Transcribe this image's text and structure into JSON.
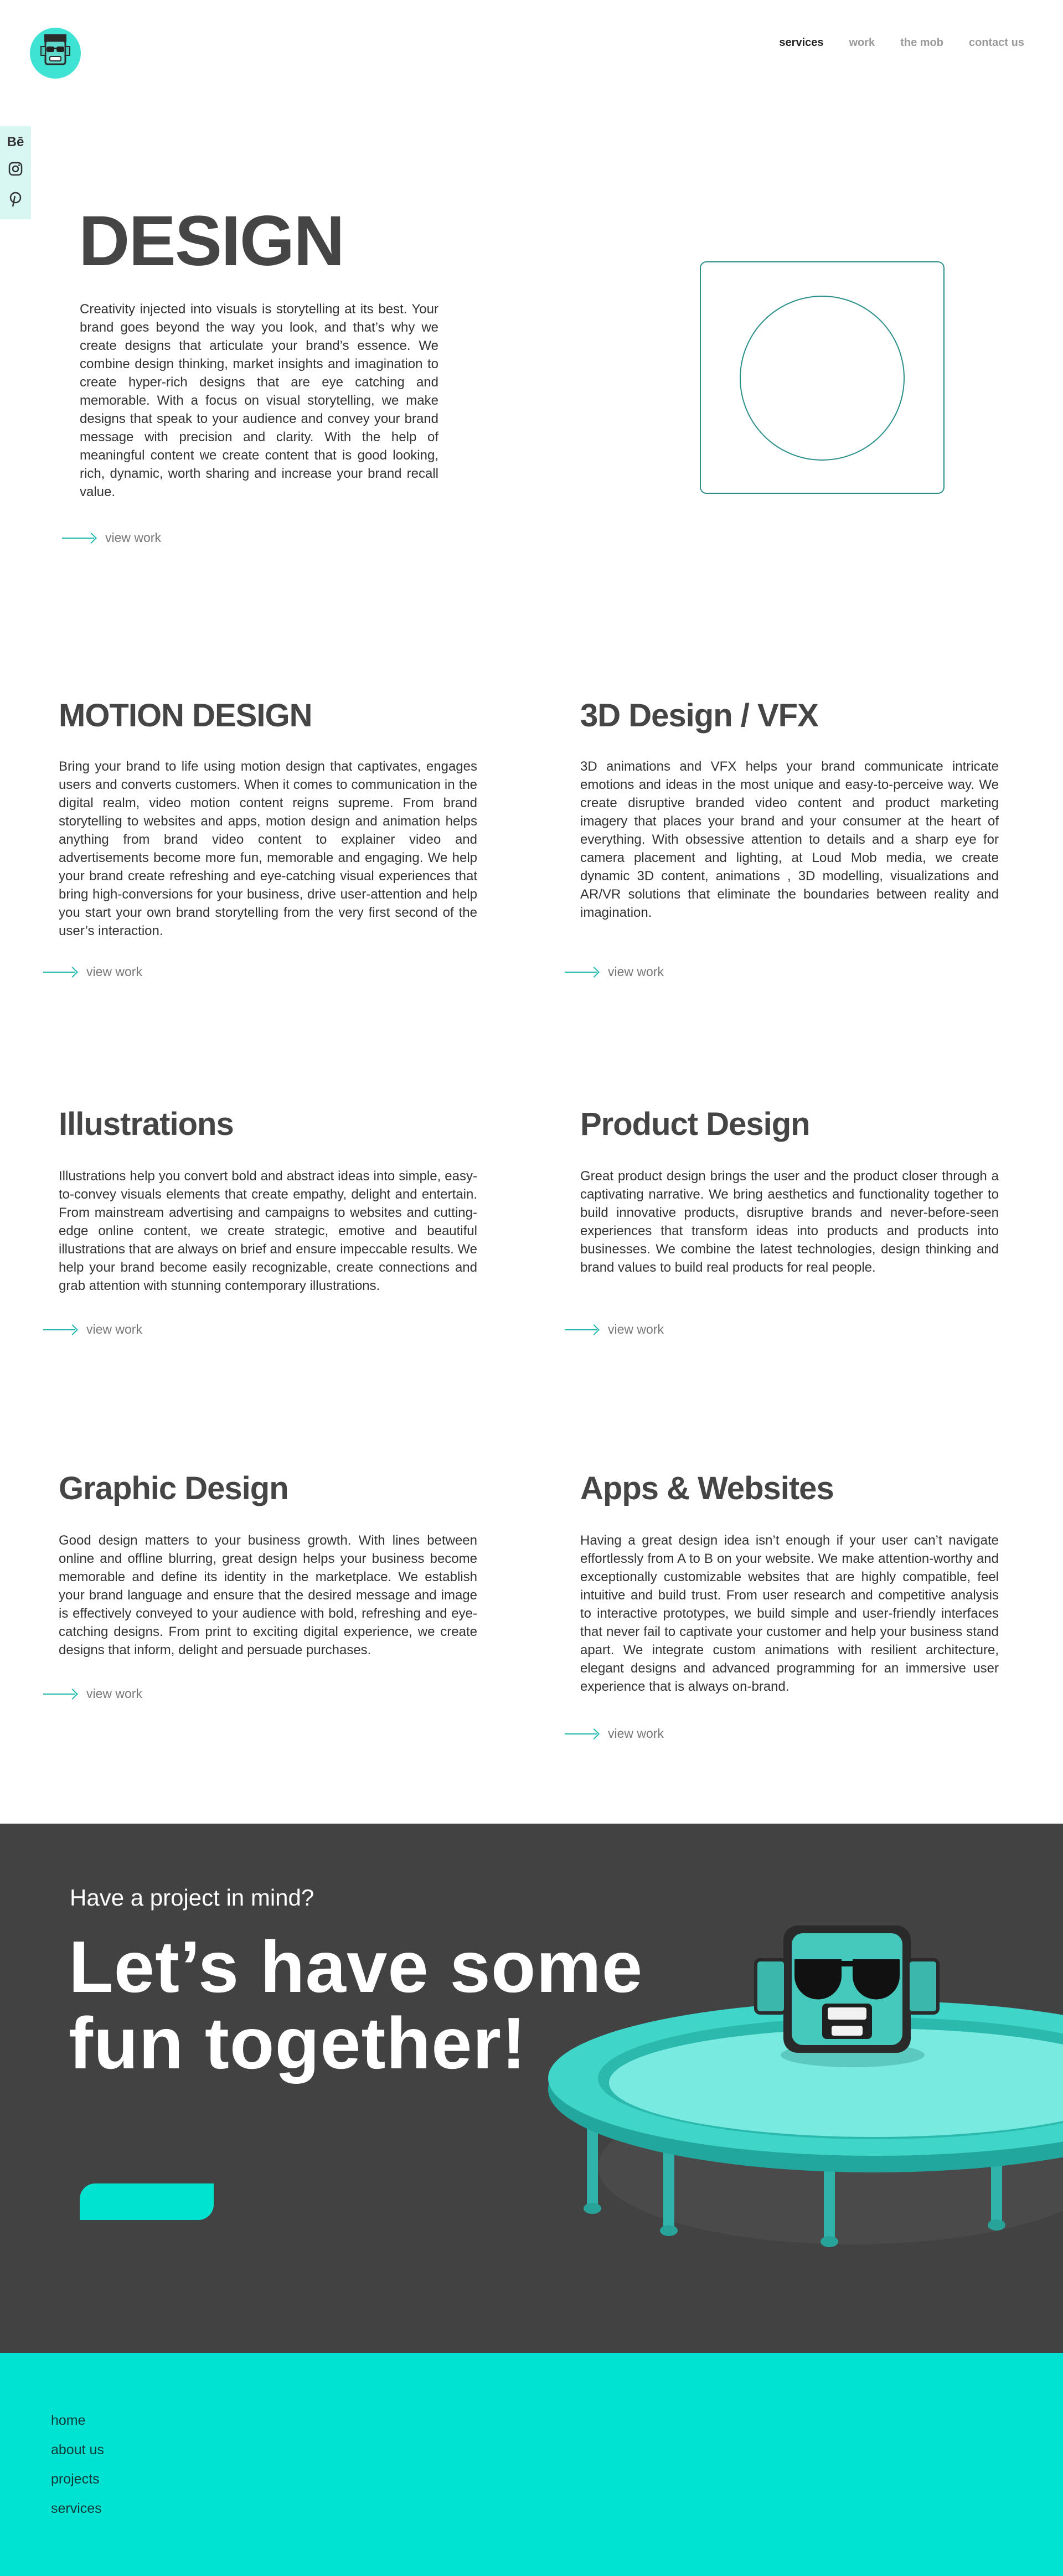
{
  "header": {
    "nav": [
      {
        "label": "services",
        "active": true
      },
      {
        "label": "work",
        "active": false
      },
      {
        "label": "the mob",
        "active": false
      },
      {
        "label": "contact us",
        "active": false
      }
    ]
  },
  "social": [
    {
      "icon": "behance-icon",
      "glyph": "Bē"
    },
    {
      "icon": "instagram-icon",
      "glyph": "◎"
    },
    {
      "icon": "pinterest-icon",
      "glyph": "𝒫"
    }
  ],
  "hero": {
    "title": "DESIGN",
    "text": "Creativity injected into visuals is storytelling at its best. Your brand goes beyond the way you look, and that’s why we create designs that articulate your brand’s essence. We combine design thinking, market insights and imagination to create hyper-rich designs that are eye catching and memorable. With a focus on visual storytelling, we make designs that speak to your audience and convey your brand message with precision and clarity. With the help of meaningful content we create content that is good looking, rich, dynamic, worth sharing and increase your brand recall value.",
    "link": "view work"
  },
  "services": [
    {
      "title": "MOTION DESIGN",
      "text": "Bring your brand to life using motion design that captivates, engages users and converts customers. When it comes to communication in the digital realm, video motion content reigns supreme. From brand storytelling to websites and apps, motion design and animation helps anything from brand video content to explainer video and advertisements become more fun, memorable and engaging. We help your brand create refreshing and eye-catching visual experiences that bring high-conversions for your business, drive user-attention and help you start your own brand storytelling from the very first second of the user’s interaction.",
      "link": "view work"
    },
    {
      "title": "3D Design / VFX",
      "text": "3D animations and VFX helps your brand communicate intricate emotions and ideas in the most unique and easy-to-perceive way. We create disruptive branded video content and product marketing imagery that places your brand and your consumer at the heart of everything. With obsessive attention to details and a sharp eye for camera placement and lighting, at Loud Mob media, we create dynamic 3D content, animations , 3D modelling, visualizations and AR/VR solutions that eliminate the boundaries between reality and imagination.",
      "link": "view work"
    },
    {
      "title": "Illustrations",
      "text": "Illustrations help you convert bold and abstract ideas into simple, easy-to-convey visuals elements that create empathy, delight and entertain. From mainstream advertising and campaigns to websites and cutting-edge online content, we create strategic, emotive and beautiful illustrations that are always on brief and ensure impeccable results. We help your brand become easily recognizable, create connections and grab attention with stunning contemporary illustrations.",
      "link": "view work"
    },
    {
      "title": "Product Design",
      "text": "Great product design brings the user and the product closer through a captivating narrative. We bring aesthetics and functionality together to build innovative products, disruptive brands and never-before-seen experiences that transform ideas into products and products into businesses. We combine the latest technologies, design thinking and brand values to build real products for real people.",
      "link": "view work"
    },
    {
      "title": "Graphic Design",
      "text": "Good design matters to your business growth. With lines between online and offline blurring, great design helps your business become memorable and define its identity in the marketplace. We establish your brand language and ensure that the desired message and image is effectively conveyed to your audience with bold, refreshing and eye-catching designs. From print to exciting digital experience, we create designs that inform, delight and persuade purchases.",
      "link": "view work"
    },
    {
      "title": "Apps & Websites",
      "text": "Having a great design idea isn’t enough if your user can’t navigate effortlessly from A to B on your website. We make attention-worthy and exceptionally customizable websites that are highly compatible, feel intuitive and build trust. From user research and competitive analysis to interactive prototypes, we build simple and user-friendly interfaces that never fail to captivate your customer and help your business stand apart. We integrate custom animations with resilient architecture, elegant designs and advanced programming for an immersive user experience that is always on-brand.",
      "link": "view work"
    }
  ],
  "cta": {
    "kicker": "Have a project in mind?",
    "headline_1": "Let’s have some",
    "headline_2": "fun together!"
  },
  "footer": {
    "links": [
      "home",
      "about us",
      "projects",
      "services"
    ]
  },
  "colors": {
    "accent": "#00e3d3",
    "dark": "#424242",
    "text": "#454545",
    "line": "#2a8f8a"
  }
}
